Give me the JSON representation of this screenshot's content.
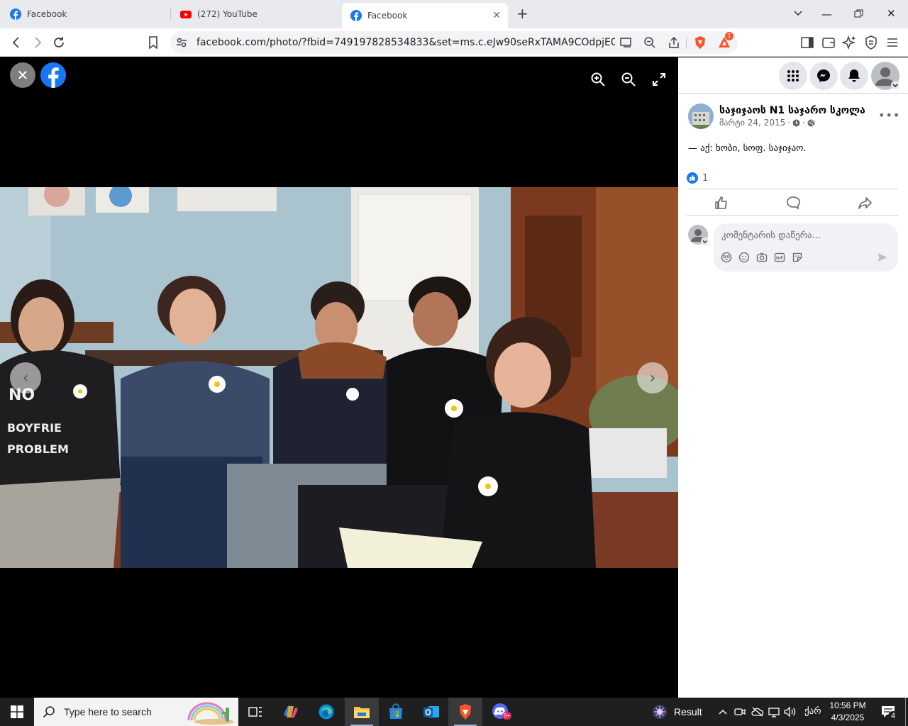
{
  "browser": {
    "tabs": [
      {
        "title": "Facebook",
        "favicon": "facebook-icon",
        "active": false
      },
      {
        "title": "(272) YouTube",
        "favicon": "youtube-icon",
        "active": false
      },
      {
        "title": "Facebook",
        "favicon": "facebook-icon",
        "active": true
      }
    ],
    "url": "facebook.com/photo/?fbid=749197828534833&set=ms.c.eJw90seRxTAMA9COdpjE0H9jOwa...",
    "brave_rewards_badge": "1",
    "colors": {
      "facebook_blue": "#1877f2",
      "youtube_red": "#ff0000",
      "brave_orange": "#fb542b"
    }
  },
  "post": {
    "page_name": "საჯიჯაოს N1 საჯარო სკოლა",
    "date": "მარტი 24, 2015",
    "date_sep": "·",
    "caption": "— აქ: ხობი, სოფ. საჯიჯაო.",
    "like_count": "1",
    "comment_placeholder": "კომენტარის დაწერა..."
  },
  "taskbar": {
    "search_placeholder": "Type here to search",
    "weather_label": "Result",
    "keyboard_lang": "ქარ",
    "time": "10:56 PM",
    "date": "4/3/2025",
    "notification_count": "4",
    "discord_badge": "9+"
  }
}
